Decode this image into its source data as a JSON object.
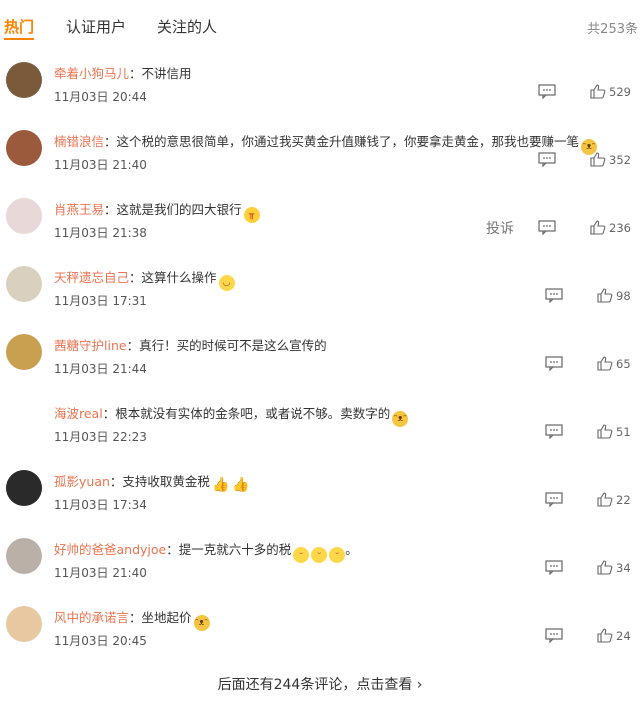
{
  "tabs": [
    "热门",
    "认证用户",
    "关注的人"
  ],
  "total": "共253条",
  "comments": [
    {
      "user": "牵着小狗马儿",
      "text": "不讲信用",
      "emojis": [],
      "time": "11月03日 20:44",
      "likes": "529",
      "report": "",
      "avatar_color": "#7a5a3a"
    },
    {
      "user": "楠错浪信",
      "text": "这个税的意思很简单，你通过我买黄金升值赚钱了，你要拿走黄金，那我也要赚一笔",
      "emojis": [
        "cat"
      ],
      "time": "11月03日 21:40",
      "likes": "352",
      "report": "",
      "avatar_color": "#9b5a3c"
    },
    {
      "user": "肖燕王易",
      "text": "这就是我们的四大银行",
      "emojis": [
        "cry"
      ],
      "time": "11月03日 21:38",
      "likes": "236",
      "report": "投诉",
      "avatar_color": "#e8d8d8"
    },
    {
      "user": "天秤遗忘自己",
      "text": "这算什么操作",
      "emojis": [
        "laugh"
      ],
      "time": "11月03日 17:31",
      "likes": "98",
      "report": "",
      "avatar_color": "#d9d0c0"
    },
    {
      "user": "茜糖守护line",
      "text": "真行！买的时候可不是这么宣传的",
      "emojis": [],
      "time": "11月03日 21:44",
      "likes": "65",
      "report": "",
      "avatar_color": "#c8a050"
    },
    {
      "user": "海波real",
      "text": "根本就没有实体的金条吧，或者说不够。卖数字的",
      "emojis": [
        "cat"
      ],
      "time": "11月03日 22:23",
      "likes": "51",
      "report": "",
      "avatar_color": "#ffffff"
    },
    {
      "user": "孤影yuan",
      "text": "支持收取黄金税",
      "emojis": [
        "thumb",
        "thumb"
      ],
      "time": "11月03日 17:34",
      "likes": "22",
      "report": "",
      "avatar_color": "#2a2a2a"
    },
    {
      "user": "好帅的爸爸andyjoe",
      "text": "提一克就六十多的税",
      "emojis": [
        "grin",
        "grin",
        "grin"
      ],
      "suffix": "。",
      "time": "11月03日 21:40",
      "likes": "34",
      "report": "",
      "avatar_color": "#bbb0a8"
    },
    {
      "user": "风中的承诺言",
      "text": "坐地起价",
      "emojis": [
        "cat"
      ],
      "time": "11月03日 20:45",
      "likes": "24",
      "report": "",
      "avatar_color": "#e8c8a0"
    }
  ],
  "more_link": "后面还有244条评论，点击查看 ›"
}
